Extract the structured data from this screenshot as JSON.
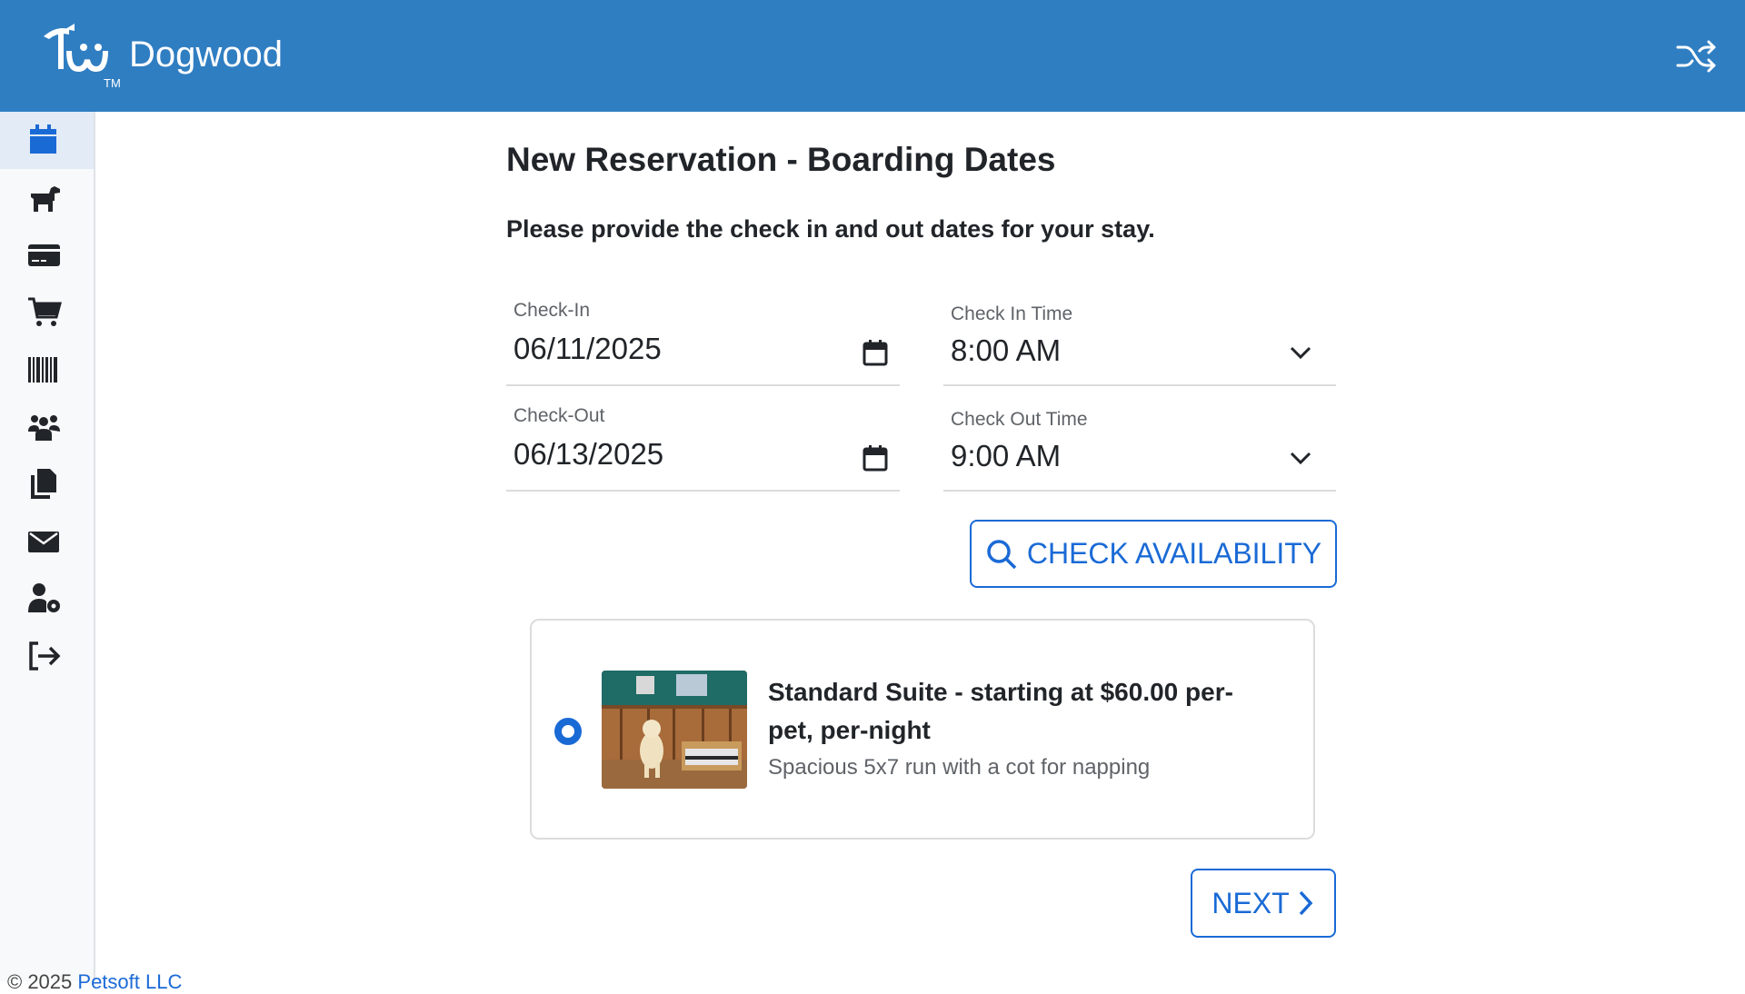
{
  "header": {
    "brand_name": "Dogwood",
    "trademark": "TM",
    "brand_color": "#307ec2",
    "right_icon": "shuffle-icon"
  },
  "sidebar": {
    "items": [
      {
        "icon": "calendar-icon",
        "active": true
      },
      {
        "icon": "dog-icon"
      },
      {
        "icon": "credit-card-icon"
      },
      {
        "icon": "cart-icon"
      },
      {
        "icon": "barcode-icon"
      },
      {
        "icon": "users-icon"
      },
      {
        "icon": "documents-icon"
      },
      {
        "icon": "envelope-icon"
      },
      {
        "icon": "user-gear-icon"
      },
      {
        "icon": "logout-icon"
      }
    ]
  },
  "main": {
    "title": "New Reservation - Boarding Dates",
    "subtitle": "Please provide the check in and out dates for your stay.",
    "check_in": {
      "label": "Check-In",
      "value": "06/11/2025"
    },
    "check_in_time": {
      "label": "Check In Time",
      "value": "8:00 AM"
    },
    "check_out": {
      "label": "Check-Out",
      "value": "06/13/2025"
    },
    "check_out_time": {
      "label": "Check Out Time",
      "value": "9:00 AM"
    },
    "check_availability_label": "CHECK AVAILABILITY",
    "suite": {
      "title": "Standard Suite - starting at $60.00 per-pet, per-night",
      "description": "Spacious 5x7 run with a cot for napping",
      "selected": true
    },
    "next_label": "NEXT"
  },
  "footer": {
    "copyright": "© 2025 ",
    "company": "Petsoft LLC"
  },
  "colors": {
    "accent": "#1a6ad6",
    "sidebar_active": "#e2ebf6"
  }
}
